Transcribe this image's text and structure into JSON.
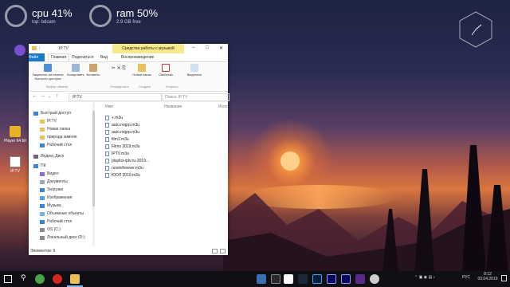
{
  "widgets": {
    "cpu": {
      "label": "cpu 41%",
      "sub": "top: bdcam"
    },
    "ram": {
      "label": "ram 50%",
      "sub": "2.9 GB free"
    }
  },
  "desktop_icons": [
    {
      "name": "Player 64 bit"
    },
    {
      "name": "IP.TV"
    }
  ],
  "window": {
    "title": "IP.TV",
    "context_tab": "Средства работы с музыкой",
    "tabs": [
      "Файл",
      "Главная",
      "Поделиться",
      "Вид",
      "Воспроизведение"
    ],
    "ribbon": {
      "pin": "Закрепить на панели быстрого доступа",
      "copy": "Копировать",
      "paste": "Вставить",
      "new_folder": "Новая папка",
      "properties": "Свойства",
      "select": "Выделить",
      "groups": [
        "Буфер обмена",
        "Упорядочить",
        "Создать",
        "Открыть"
      ]
    },
    "address": "IP.TV",
    "search_placeholder": "Поиск: IP.TV",
    "columns": [
      "Имя",
      "Название",
      "Испо"
    ],
    "sidebar": [
      {
        "label": "Быстрый доступ"
      },
      {
        "label": "IP.TV"
      },
      {
        "label": "Новая папка"
      },
      {
        "label": "природа зимняя"
      },
      {
        "label": "Рабочий стол"
      },
      {
        "label": "Яндекс.Диск"
      },
      {
        "label": "ПК"
      },
      {
        "label": "Видео"
      },
      {
        "label": "Документы"
      },
      {
        "label": "Загрузки"
      },
      {
        "label": "Изображения"
      },
      {
        "label": "Музыка"
      },
      {
        "label": "Объемные объекты"
      },
      {
        "label": "Рабочий стол"
      },
      {
        "label": "OS (C:)"
      },
      {
        "label": "Локальный диск (D:)"
      }
    ],
    "files": [
      {
        "name": "+.m3u"
      },
      {
        "name": "auto.nogrp.m3u"
      },
      {
        "name": "auto.nogrp.m3u"
      },
      {
        "name": "film1.m3u"
      },
      {
        "name": "Films 2019.m3u"
      },
      {
        "name": "IPTV.m3u"
      },
      {
        "name": "playlist-iptv.ru-2019..."
      },
      {
        "name": "russtvforever.m3u"
      },
      {
        "name": "ЮОЛ 2019.m3u"
      }
    ],
    "status": "Элементов: 9"
  },
  "taskbar": {
    "lang": "РУС",
    "time": "8:12",
    "date": "03.04.2019"
  }
}
